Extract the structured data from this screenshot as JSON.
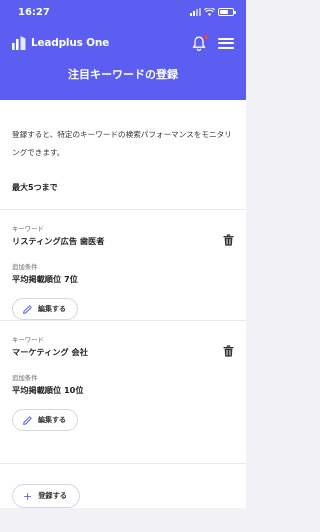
{
  "status_bar": {
    "time": "16:27"
  },
  "app_bar": {
    "brand": "Leadplus One"
  },
  "page": {
    "title": "注目キーワードの登録"
  },
  "description": "登録すると、特定のキーワードの検索パフォーマンスをモニタリングできます。",
  "max_label": "最大5つまで",
  "keywords": [
    {
      "keyword_label": "キーワード",
      "keyword": "リスティング広告 歯医者",
      "condition_label": "追加条件",
      "condition": "平均掲載順位 7位",
      "edit_label": "編集する"
    },
    {
      "keyword_label": "キーワード",
      "keyword": "マーケティング 会社",
      "condition_label": "追加条件",
      "condition": "平均掲載順位 10位",
      "edit_label": "編集する"
    }
  ],
  "add_button_label": "登録する",
  "colors": {
    "accent": "#5b5ef0",
    "badge": "#ef4444"
  },
  "icons": [
    "logo-mark-icon",
    "bell-icon",
    "menu-icon",
    "trash-icon",
    "pencil-icon",
    "plus-icon"
  ]
}
